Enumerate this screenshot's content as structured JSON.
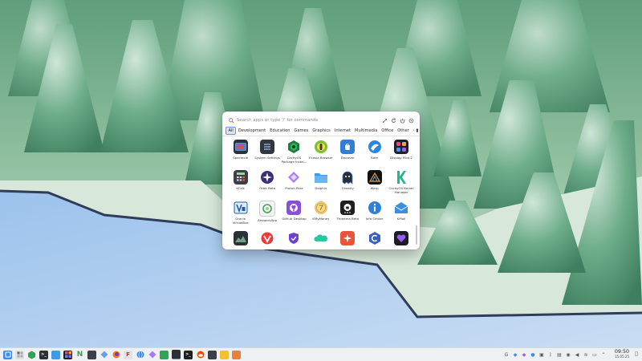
{
  "launcher": {
    "search_placeholder": "Search apps or type '/' for commands",
    "tabs": [
      "All",
      "Development",
      "Education",
      "Games",
      "Graphics",
      "Internet",
      "Multimedia",
      "Office",
      "Other"
    ],
    "active_tab": "All",
    "apps": [
      {
        "label": "Spectacle",
        "icon": "spectacle-icon"
      },
      {
        "label": "System Settings",
        "icon": "settings-icon"
      },
      {
        "label": "CachyOS Package Instal...",
        "icon": "cachyos-package-icon"
      },
      {
        "label": "Ecosia Browser",
        "icon": "ecosia-icon"
      },
      {
        "label": "Discover",
        "icon": "discover-icon"
      },
      {
        "label": "Kate",
        "icon": "kate-icon"
      },
      {
        "label": "Display Pilot 2",
        "icon": "display-pilot-icon"
      },
      {
        "label": "KCalc",
        "icon": "kcalc-icon"
      },
      {
        "label": "Orbit Beta",
        "icon": "orbit-icon"
      },
      {
        "label": "Proton Pass",
        "icon": "proton-pass-icon"
      },
      {
        "label": "Dolphin",
        "icon": "dolphin-icon"
      },
      {
        "label": "Ghostty",
        "icon": "ghostty-icon"
      },
      {
        "label": "Warp",
        "icon": "warp-icon"
      },
      {
        "label": "CachyOS Kernel Manager",
        "icon": "kernel-manager-icon"
      },
      {
        "label": "Oracle VirtualBox",
        "icon": "virtualbox-icon"
      },
      {
        "label": "AnswersApp",
        "icon": "answers-icon"
      },
      {
        "label": "Github Desktop",
        "icon": "github-icon"
      },
      {
        "label": "KMyMoney",
        "icon": "kmymoney-icon"
      },
      {
        "label": "Threema Beta",
        "icon": "threema-icon"
      },
      {
        "label": "Info Center",
        "icon": "info-icon"
      },
      {
        "label": "KMail",
        "icon": "kmail-icon"
      },
      {
        "label": "",
        "icon": "monitor-icon"
      },
      {
        "label": "",
        "icon": "vivaldi-icon"
      },
      {
        "label": "",
        "icon": "shield-icon"
      },
      {
        "label": "",
        "icon": "clouds-icon"
      },
      {
        "label": "",
        "icon": "brave-icon"
      },
      {
        "label": "",
        "icon": "cpp-icon"
      },
      {
        "label": "",
        "icon": "heart-icon"
      }
    ]
  },
  "taskbar": {
    "clock_time": "09:50",
    "clock_date": "15.05.25"
  },
  "colors": {
    "accent": "#3d8ee8",
    "panel": "#eef0f2",
    "launcher_bg": "#ffffff"
  }
}
